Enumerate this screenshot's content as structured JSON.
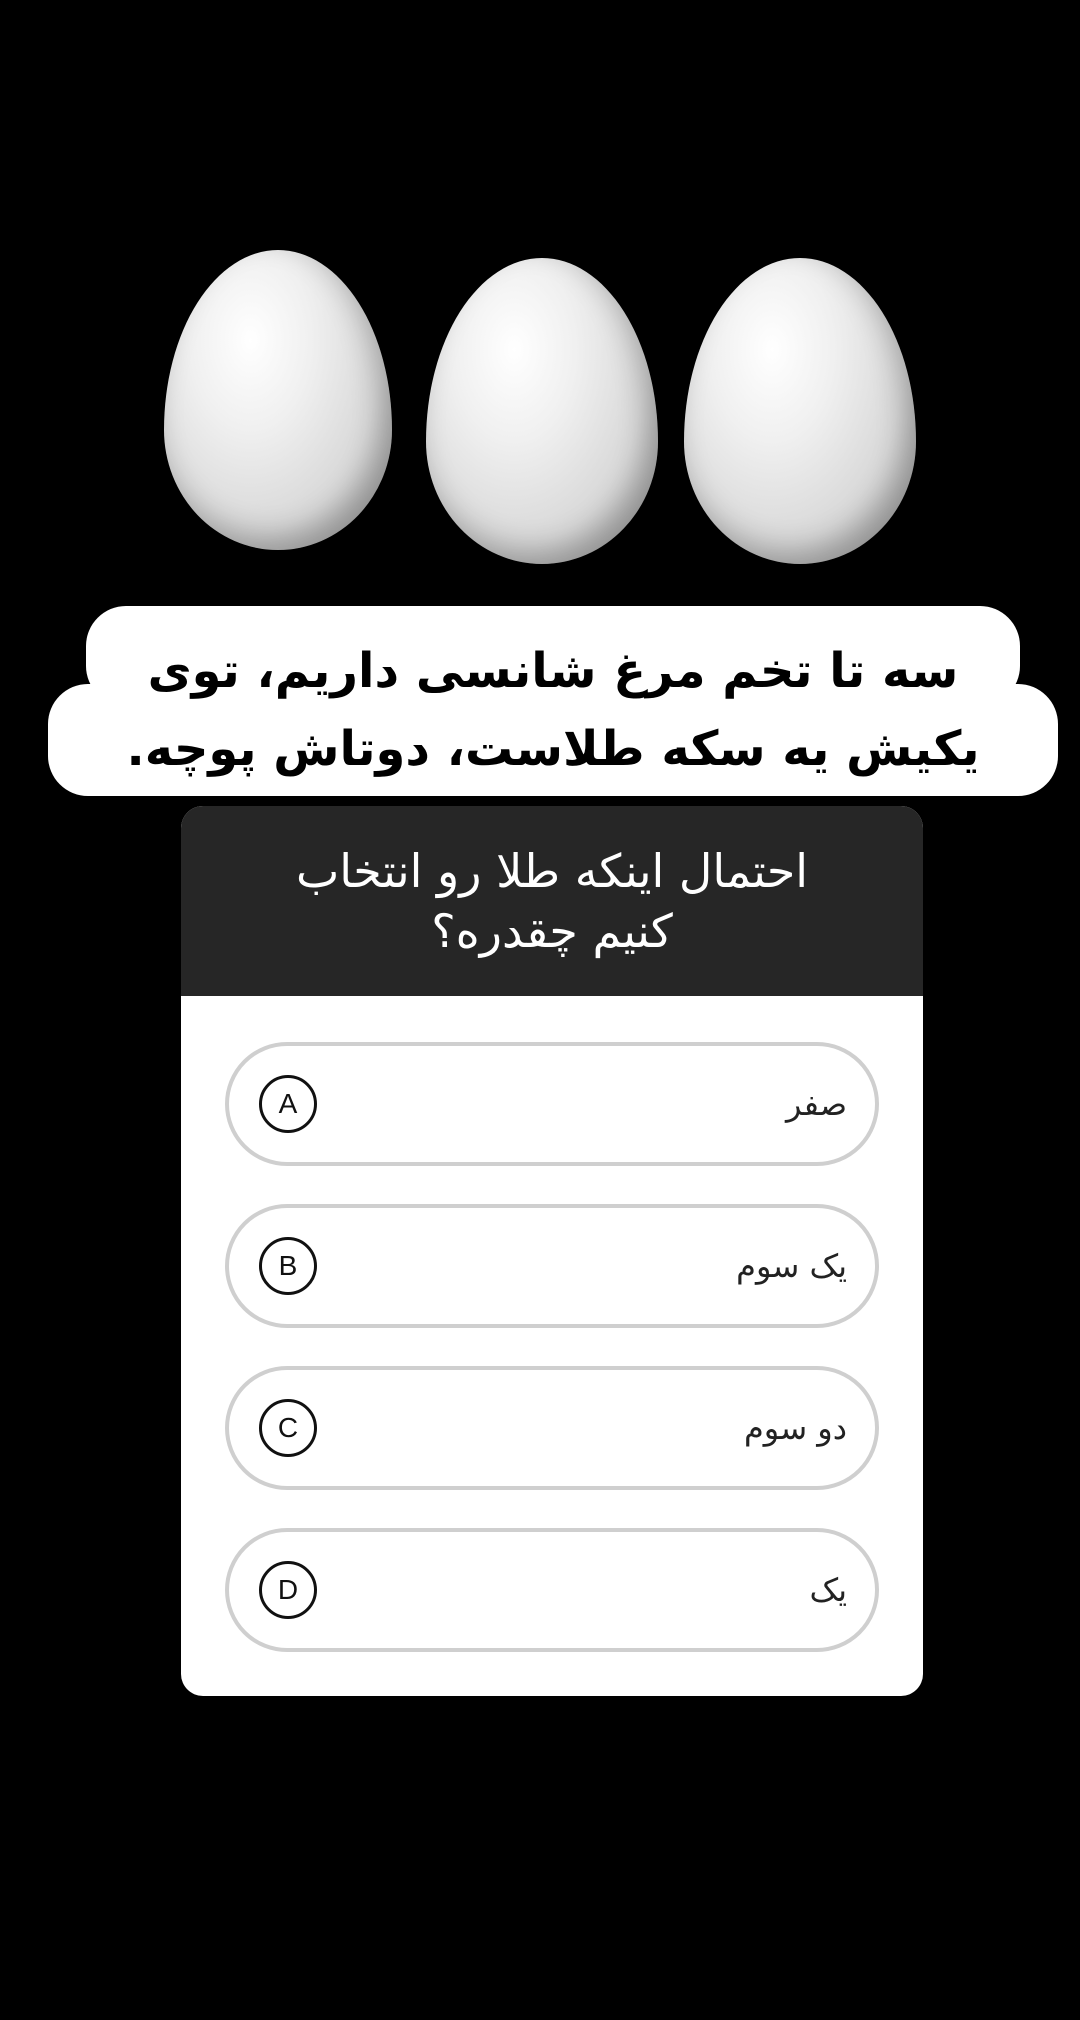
{
  "caption": {
    "text": "سه تا تخم مرغ شانسی داریم، توی یکیش یه سکه طلاست، دوتاش پوچه."
  },
  "quiz": {
    "question": "احتمال اینکه طلا رو انتخاب کنیم چقدره؟",
    "options": [
      {
        "letter": "A",
        "text": "صفر"
      },
      {
        "letter": "B",
        "text": "یک سوم"
      },
      {
        "letter": "C",
        "text": "دو سوم"
      },
      {
        "letter": "D",
        "text": "یک"
      }
    ]
  },
  "colors": {
    "background": "#000000",
    "quiz_header": "#262626",
    "option_border": "#cfcfcf"
  }
}
